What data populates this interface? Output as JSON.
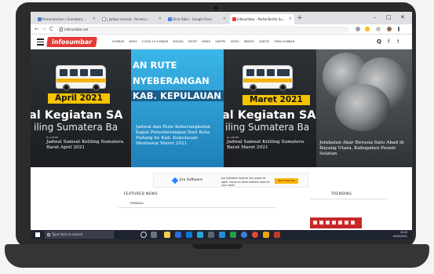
{
  "browser": {
    "tabs": [
      {
        "label": "Pemerintahan | Sumatera...",
        "favicon_color": "#4a7bd0"
      },
      {
        "label": "| jadwal samsat - Penelus...",
        "favicon_color": "#e8e8e8"
      },
      {
        "label": "Dina Tabel - Google Docs",
        "favicon_color": "#4285f4"
      },
      {
        "label": "infosumbar - Portal Berita Su...",
        "favicon_color": "#e53935"
      }
    ],
    "new_tab": "+",
    "window_controls": {
      "minimize": "–",
      "maximize": "□",
      "close": "✕"
    },
    "url": "infosumbar.net",
    "nav": {
      "back": "←",
      "forward": "→",
      "reload": "C"
    }
  },
  "site": {
    "logo": "infosumbar",
    "menu": [
      "SUMBAR",
      "NEWS",
      "COVID-19 SUMBAR",
      "WISATA",
      "SPORT",
      "INDEX",
      "SANTRI",
      "VIDEO",
      "INDEKS",
      "SANTRI",
      "OPINI SUMBAR"
    ],
    "header_icons": {
      "search": "Q",
      "facebook": "f",
      "twitter": "t"
    }
  },
  "hero": {
    "p1": {
      "month": "April 2021",
      "title_line": "al Kegiatan SA",
      "sub_line": "iling Sumatera Ba",
      "author": "By ADMIN",
      "caption": "Jadwal Samsat Keliling Sumatera Barat April 2021"
    },
    "p2": {
      "route_lines": [
        "AN RUTE",
        "NYEBERANGAN",
        "KAB. KEPULAUAN M"
      ],
      "caption": "Jadwal dan Rute Keberangkatan Kapal Penyeberangan Dari Kota Padang ke Kab. Kepulauan Mentawai Maret 2021"
    },
    "p3": {
      "month": "Maret 2021",
      "title_line": "al Kegiatan SAN",
      "sub_line": "iling Sumatera Ba",
      "author": "By ADMIN",
      "caption": "Jadwal Samsat Keliling Sumatera Barat Maret 2021"
    },
    "p4": {
      "caption": "Jembatan Akar Berusia Satu Abad di Bayang Utara, Kabupaten Pesisir Selatan"
    }
  },
  "ad": {
    "brand": "Jira Software",
    "blurb": "Jira Software unlocks the power of agile. Focus on what matters most to your team.",
    "cta": "Start free trial"
  },
  "sections": {
    "featured_title": "FEATURED NEWS",
    "featured_tab": "TERBARU",
    "trending_title": "TRENDING"
  },
  "taskbar": {
    "search_placeholder": "Type here to search",
    "tray_time": "20:45",
    "tray_date": "04/03/2021"
  },
  "colors": {
    "brand_red": "#e53935",
    "badge_yellow": "#f5c400",
    "route_blue": "#2a9bd6"
  }
}
